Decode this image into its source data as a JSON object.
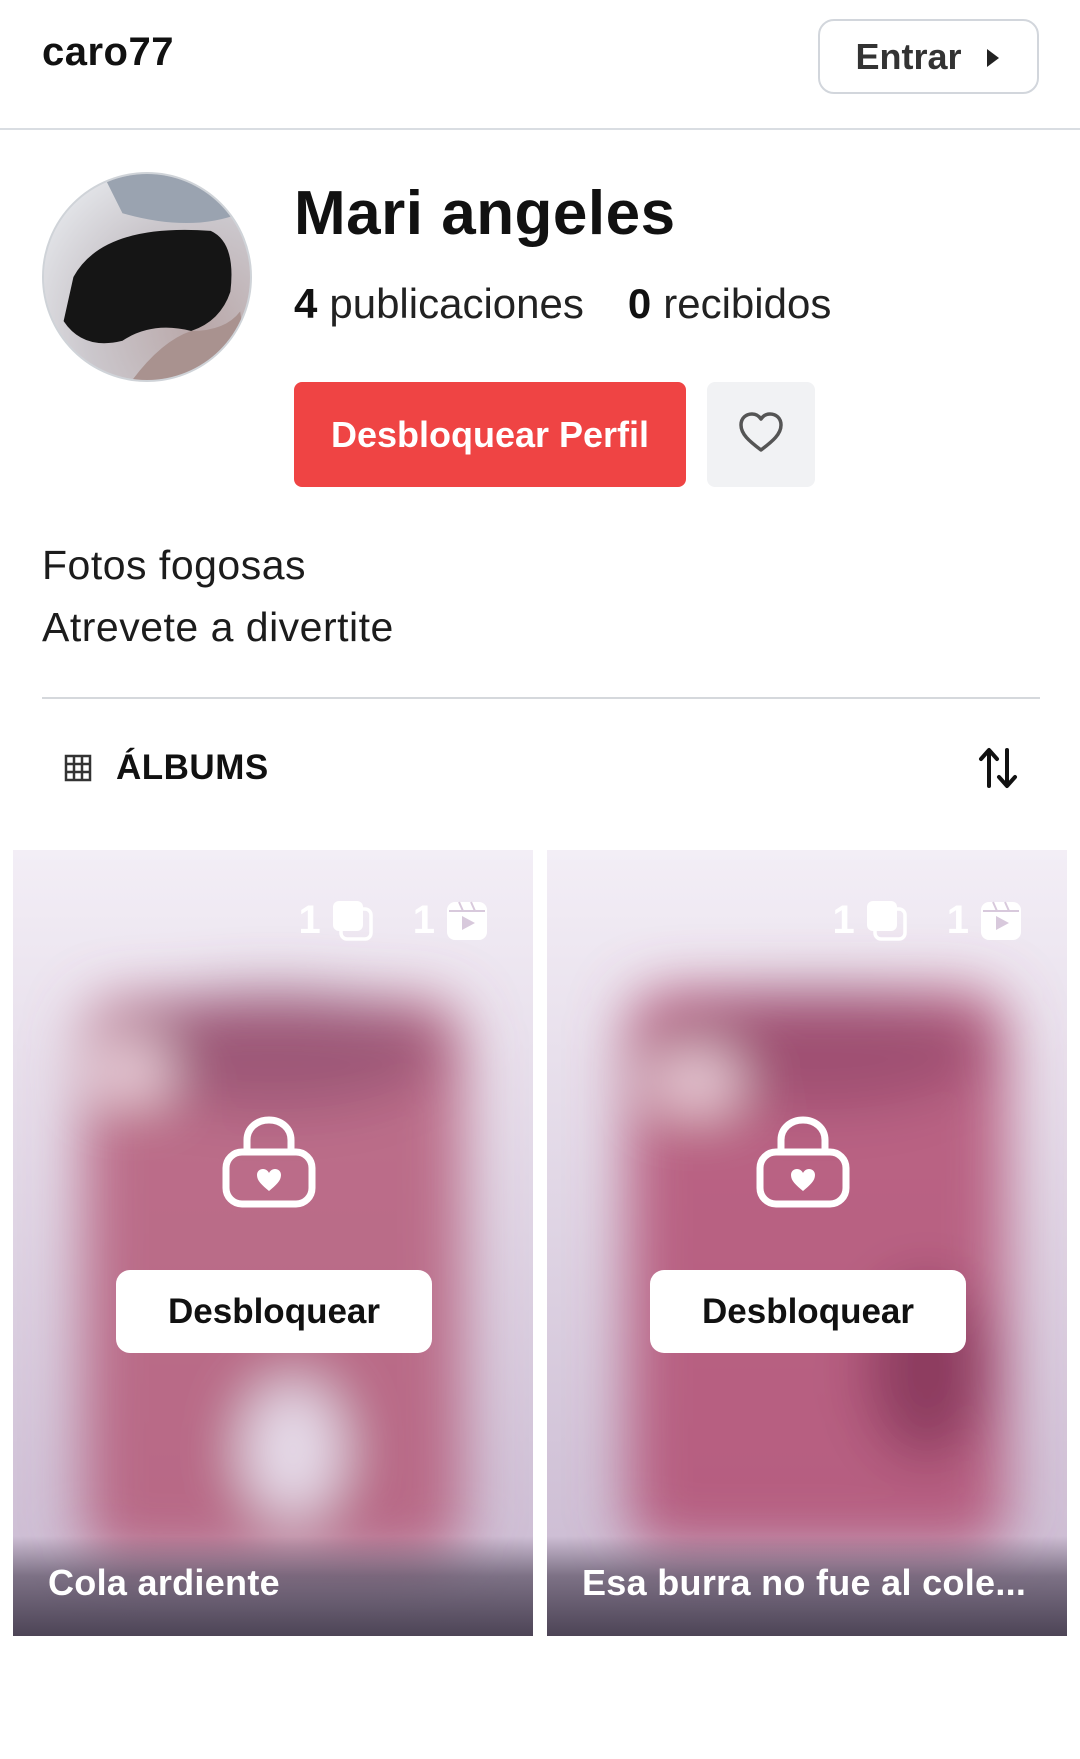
{
  "header": {
    "username": "caro77",
    "login_label": "Entrar"
  },
  "profile": {
    "name": "Mari angeles",
    "posts_count": "4",
    "posts_label": "publicaciones",
    "received_count": "0",
    "received_label": "recibidos",
    "unlock_profile_label": "Desbloquear Perfil",
    "bio_line_1": "Fotos fogosas",
    "bio_line_2": "Atrevete a divertite"
  },
  "section": {
    "title": "ÁLBUMS"
  },
  "albums": [
    {
      "title": "Cola ardiente",
      "photo_count": "1",
      "video_count": "1",
      "unlock_label": "Desbloquear"
    },
    {
      "title": "Esa burra no fue al cole...",
      "photo_count": "1",
      "video_count": "1",
      "unlock_label": "Desbloquear"
    }
  ],
  "colors": {
    "accent_red": "#ef4444",
    "border": "#d5d8dc",
    "fav_bg": "#f1f2f4"
  },
  "icons": {
    "login": "caret-right-icon",
    "favorite": "heart-icon",
    "section": "grid-icon",
    "sort": "sort-arrows-icon",
    "photos": "photos-stack-icon",
    "videos": "video-clapper-icon",
    "locked": "lock-heart-icon"
  }
}
